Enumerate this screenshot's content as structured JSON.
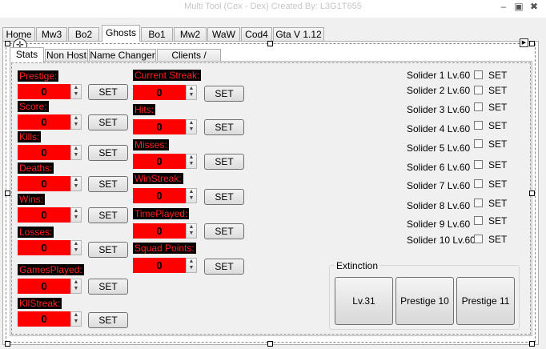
{
  "window": {
    "title": "Multi Tool (Cex - Dex) Created By: L3G1T655"
  },
  "main_tabs": [
    {
      "label": "Home"
    },
    {
      "label": "Mw3"
    },
    {
      "label": "Bo2"
    },
    {
      "label": "Ghosts",
      "active": true
    },
    {
      "label": "Bo1"
    },
    {
      "label": "Mw2"
    },
    {
      "label": "WaW"
    },
    {
      "label": "Cod4"
    },
    {
      "label": "Gta V 1.12"
    }
  ],
  "sub_tabs": [
    {
      "label": "Stats",
      "active": true
    },
    {
      "label": "Non Host"
    },
    {
      "label": "Name Changer"
    },
    {
      "label": "Clients / Lobby"
    }
  ],
  "set_label": "SET",
  "left_stats": [
    {
      "label": "Prestige:",
      "value": "0"
    },
    {
      "label": "Score:",
      "value": "0"
    },
    {
      "label": "Kills:",
      "value": "0"
    },
    {
      "label": "Deaths:",
      "value": "0"
    },
    {
      "label": "Wins:",
      "value": "0"
    },
    {
      "label": "Losses:",
      "value": "0"
    },
    {
      "label": "GamesPlayed:",
      "value": "0"
    },
    {
      "label": "KllStreak:",
      "value": "0"
    }
  ],
  "right_stats": [
    {
      "label": "Current Streak:",
      "value": "0"
    },
    {
      "label": "Hits:",
      "value": "0"
    },
    {
      "label": "Misses:",
      "value": "0"
    },
    {
      "label": "WinStreak:",
      "value": "0"
    },
    {
      "label": "TimePlayed:",
      "value": "0"
    },
    {
      "label": "Squad Points:",
      "value": "0"
    }
  ],
  "soldiers": [
    {
      "label": "Solider 1 Lv.60"
    },
    {
      "label": "Solider 2 Lv.60"
    },
    {
      "label": "Solider 3 Lv.60"
    },
    {
      "label": "Solider 4 Lv.60"
    },
    {
      "label": "Solider 5 Lv.60"
    },
    {
      "label": "Solider 6 Lv.60"
    },
    {
      "label": "Solider 7 Lv.60"
    },
    {
      "label": "Solider 8 Lv.60"
    },
    {
      "label": "Solider 9 Lv.60"
    },
    {
      "label": "Solider 10 Lv.60"
    }
  ],
  "extinction": {
    "title": "Extinction",
    "buttons": [
      {
        "label": "Lv.31"
      },
      {
        "label": "Prestige 10"
      },
      {
        "label": "Prestige 11"
      }
    ]
  },
  "colors": {
    "value_bg": "#ff0000",
    "label_text": "#ff2020",
    "label_bg": "#000000"
  }
}
